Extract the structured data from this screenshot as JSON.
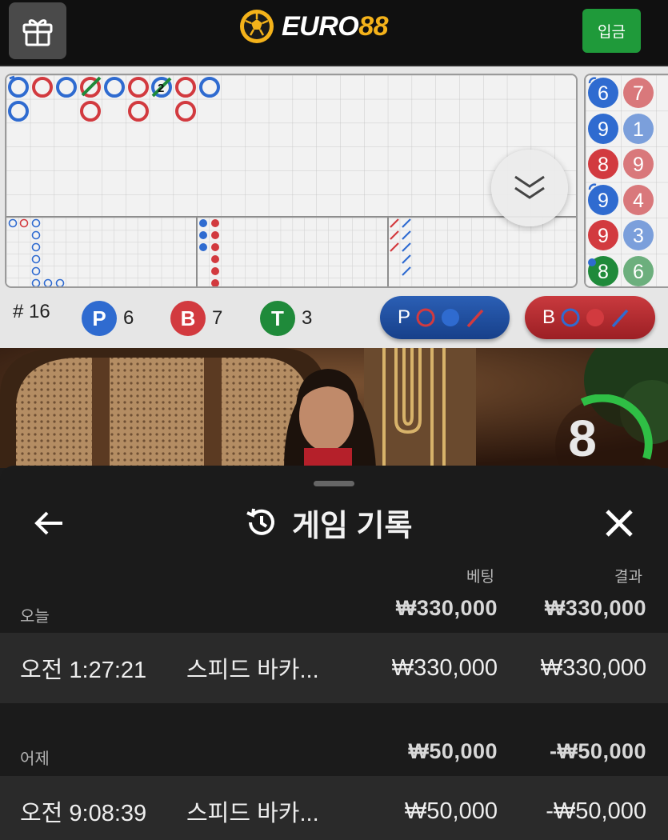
{
  "header": {
    "logo_white": "EURO",
    "logo_yellow": "88",
    "deposit_label": "입금"
  },
  "roadmap": {
    "round_label": "# 16",
    "player": {
      "letter": "P",
      "count": "6"
    },
    "banker": {
      "letter": "B",
      "count": "7"
    },
    "tie": {
      "letter": "T",
      "count": "3"
    },
    "big_road_tie_count": "2",
    "player_predict_label": "P",
    "banker_predict_label": "B",
    "bead_column_1": [
      "6",
      "9",
      "8",
      "9",
      "9",
      "8"
    ],
    "bead_column_2": [
      "7",
      "1",
      "9",
      "4",
      "3",
      "6"
    ]
  },
  "video": {
    "countdown": "8"
  },
  "history": {
    "title": "게임 기록",
    "col_bet": "베팅",
    "col_result": "결과",
    "groups": [
      {
        "day": "오늘",
        "total_bet": "₩330,000",
        "total_result": "₩330,000",
        "rows": [
          {
            "time": "오전 1:27:21",
            "game": "스피드 바카...",
            "bet": "₩330,000",
            "result": "₩330,000"
          }
        ]
      },
      {
        "day": "어제",
        "total_bet": "₩50,000",
        "total_result": "-₩50,000",
        "rows": [
          {
            "time": "오전 9:08:39",
            "game": "스피드 바카...",
            "bet": "₩50,000",
            "result": "-₩50,000"
          }
        ]
      }
    ]
  },
  "colors": {
    "player": "#2f6bd0",
    "banker": "#d23a3f",
    "tie": "#1f8a3a",
    "accent_green": "#1f9a3a",
    "logo_yellow": "#f4b21a"
  }
}
